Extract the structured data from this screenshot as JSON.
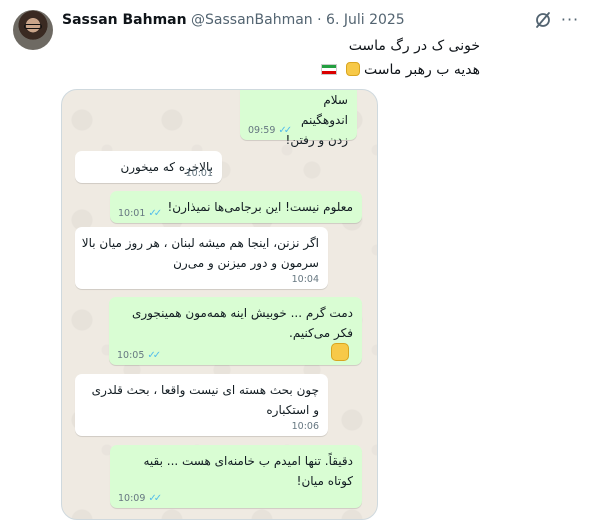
{
  "tweet": {
    "name": "Sassan Bahman",
    "handle": "@SassanBahman",
    "separator": "·",
    "date": "6. Juli 2025",
    "line1": "خونی ک در رگ ماست",
    "line2": "هدیه ب رهبر ماست",
    "icons": [
      "grok-icon",
      "more-icon",
      "iran-flag-icon",
      "fist-emoji-icon"
    ],
    "more": "···"
  },
  "chat": {
    "colors": {
      "background": "#efeae2",
      "outgoing": "#d9fdd3",
      "incoming": "#ffffff",
      "read_ticks": "#53bdeb"
    },
    "messages": [
      {
        "type": "outgoing",
        "lines": [
          "سلام",
          "اندوهگینم",
          "زدن و رفتن!"
        ],
        "time": "09:59",
        "read": true
      },
      {
        "type": "incoming",
        "lines": [
          "بالاخره که میخورن"
        ],
        "time": "10:01"
      },
      {
        "type": "outgoing",
        "lines": [
          "معلوم نیست! این برجامی‌ها نمیذارن!"
        ],
        "time": "10:01",
        "read": true
      },
      {
        "type": "incoming",
        "lines": [
          "اگر نزنن، اینجا هم میشه لبنان ، هر روز میان بالا",
          "سرمون و دور میزنن و می‌رن"
        ],
        "time": "10:04"
      },
      {
        "type": "outgoing",
        "lines": [
          "دمت گرم ... خوبیش اینه همه‌مون همینجوری",
          "فکر می‌کنیم."
        ],
        "time": "10:05",
        "read": true,
        "emoji": "fist-emoji-icon"
      },
      {
        "type": "incoming",
        "lines": [
          "چون بحث هسته ای نیست واقعا ، بحث قلدری",
          "و استکباره"
        ],
        "time": "10:06"
      },
      {
        "type": "outgoing",
        "lines": [
          "دقیقاً. تنها امیدم ب خامنه‌ای هست ... بقیه",
          "کوتاه میان!"
        ],
        "time": "10:09",
        "read": true
      }
    ]
  }
}
